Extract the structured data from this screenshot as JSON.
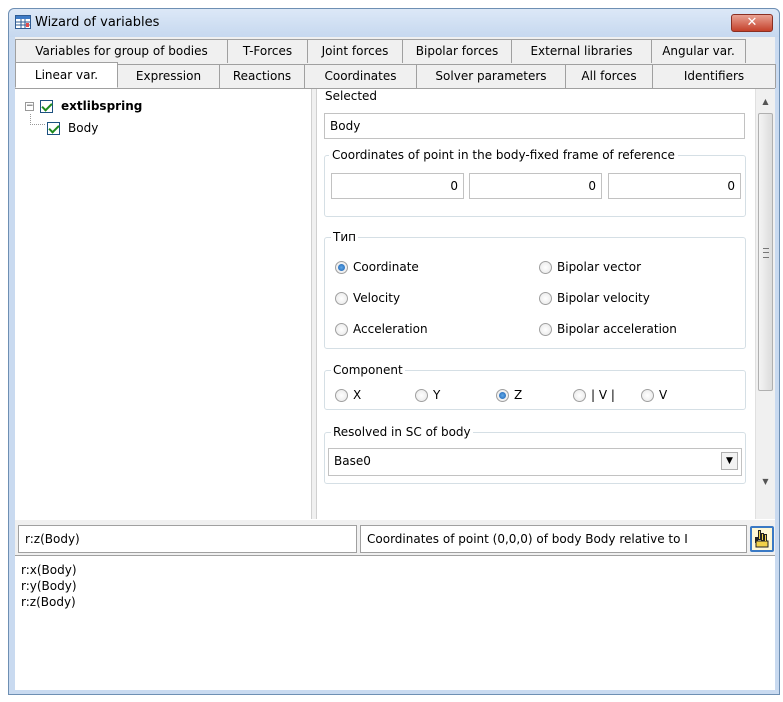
{
  "window": {
    "title": "Wizard of variables",
    "close_symbol": "✕"
  },
  "tabs_row1": [
    {
      "label": "Variables for group of bodies"
    },
    {
      "label": "T-Forces"
    },
    {
      "label": "Joint forces"
    },
    {
      "label": "Bipolar forces"
    },
    {
      "label": "External libraries"
    },
    {
      "label": "Angular var."
    }
  ],
  "tabs_row2": [
    {
      "label": "Linear var.",
      "active": true
    },
    {
      "label": "Expression"
    },
    {
      "label": "Reactions"
    },
    {
      "label": "Coordinates"
    },
    {
      "label": "Solver parameters"
    },
    {
      "label": "All forces"
    },
    {
      "label": "Identifiers"
    }
  ],
  "tree": {
    "root": {
      "label": "extlibspring",
      "expander": "−",
      "checked": true
    },
    "child": {
      "label": "Body",
      "checked": true
    }
  },
  "selected": {
    "label": "Selected",
    "value": "Body"
  },
  "point_coords": {
    "label": "Coordinates of point in the body-fixed frame of reference",
    "values": [
      "0",
      "0",
      "0"
    ]
  },
  "type_group": {
    "label": "Тип",
    "options": [
      {
        "label": "Coordinate",
        "checked": true
      },
      {
        "label": "Velocity",
        "checked": false
      },
      {
        "label": "Acceleration",
        "checked": false
      },
      {
        "label": "Bipolar vector",
        "checked": false
      },
      {
        "label": "Bipolar velocity",
        "checked": false
      },
      {
        "label": "Bipolar acceleration",
        "checked": false
      }
    ]
  },
  "component_group": {
    "label": "Component",
    "options": [
      {
        "label": "X",
        "checked": false
      },
      {
        "label": "Y",
        "checked": false
      },
      {
        "label": "Z",
        "checked": true
      },
      {
        "label": "| V |",
        "checked": false
      },
      {
        "label": "V",
        "checked": false
      }
    ]
  },
  "resolved": {
    "label": "Resolved in SC of body",
    "value": "Base0"
  },
  "bottom": {
    "variable": "r:z(Body)",
    "description": "Coordinates of point (0,0,0) of body Body relative to I"
  },
  "output_lines": [
    "r:x(Body)",
    "r:y(Body)",
    "r:z(Body)"
  ],
  "icons": {
    "window": "wizard-table-icon",
    "pick": "hand-pointer-icon",
    "close": "close-icon"
  },
  "colors": {
    "title_bar": "#c6d8ef",
    "close_button": "#c4412a",
    "checkbox_check": "#1e8a1e",
    "radio_selected": "#1b5fb0"
  }
}
